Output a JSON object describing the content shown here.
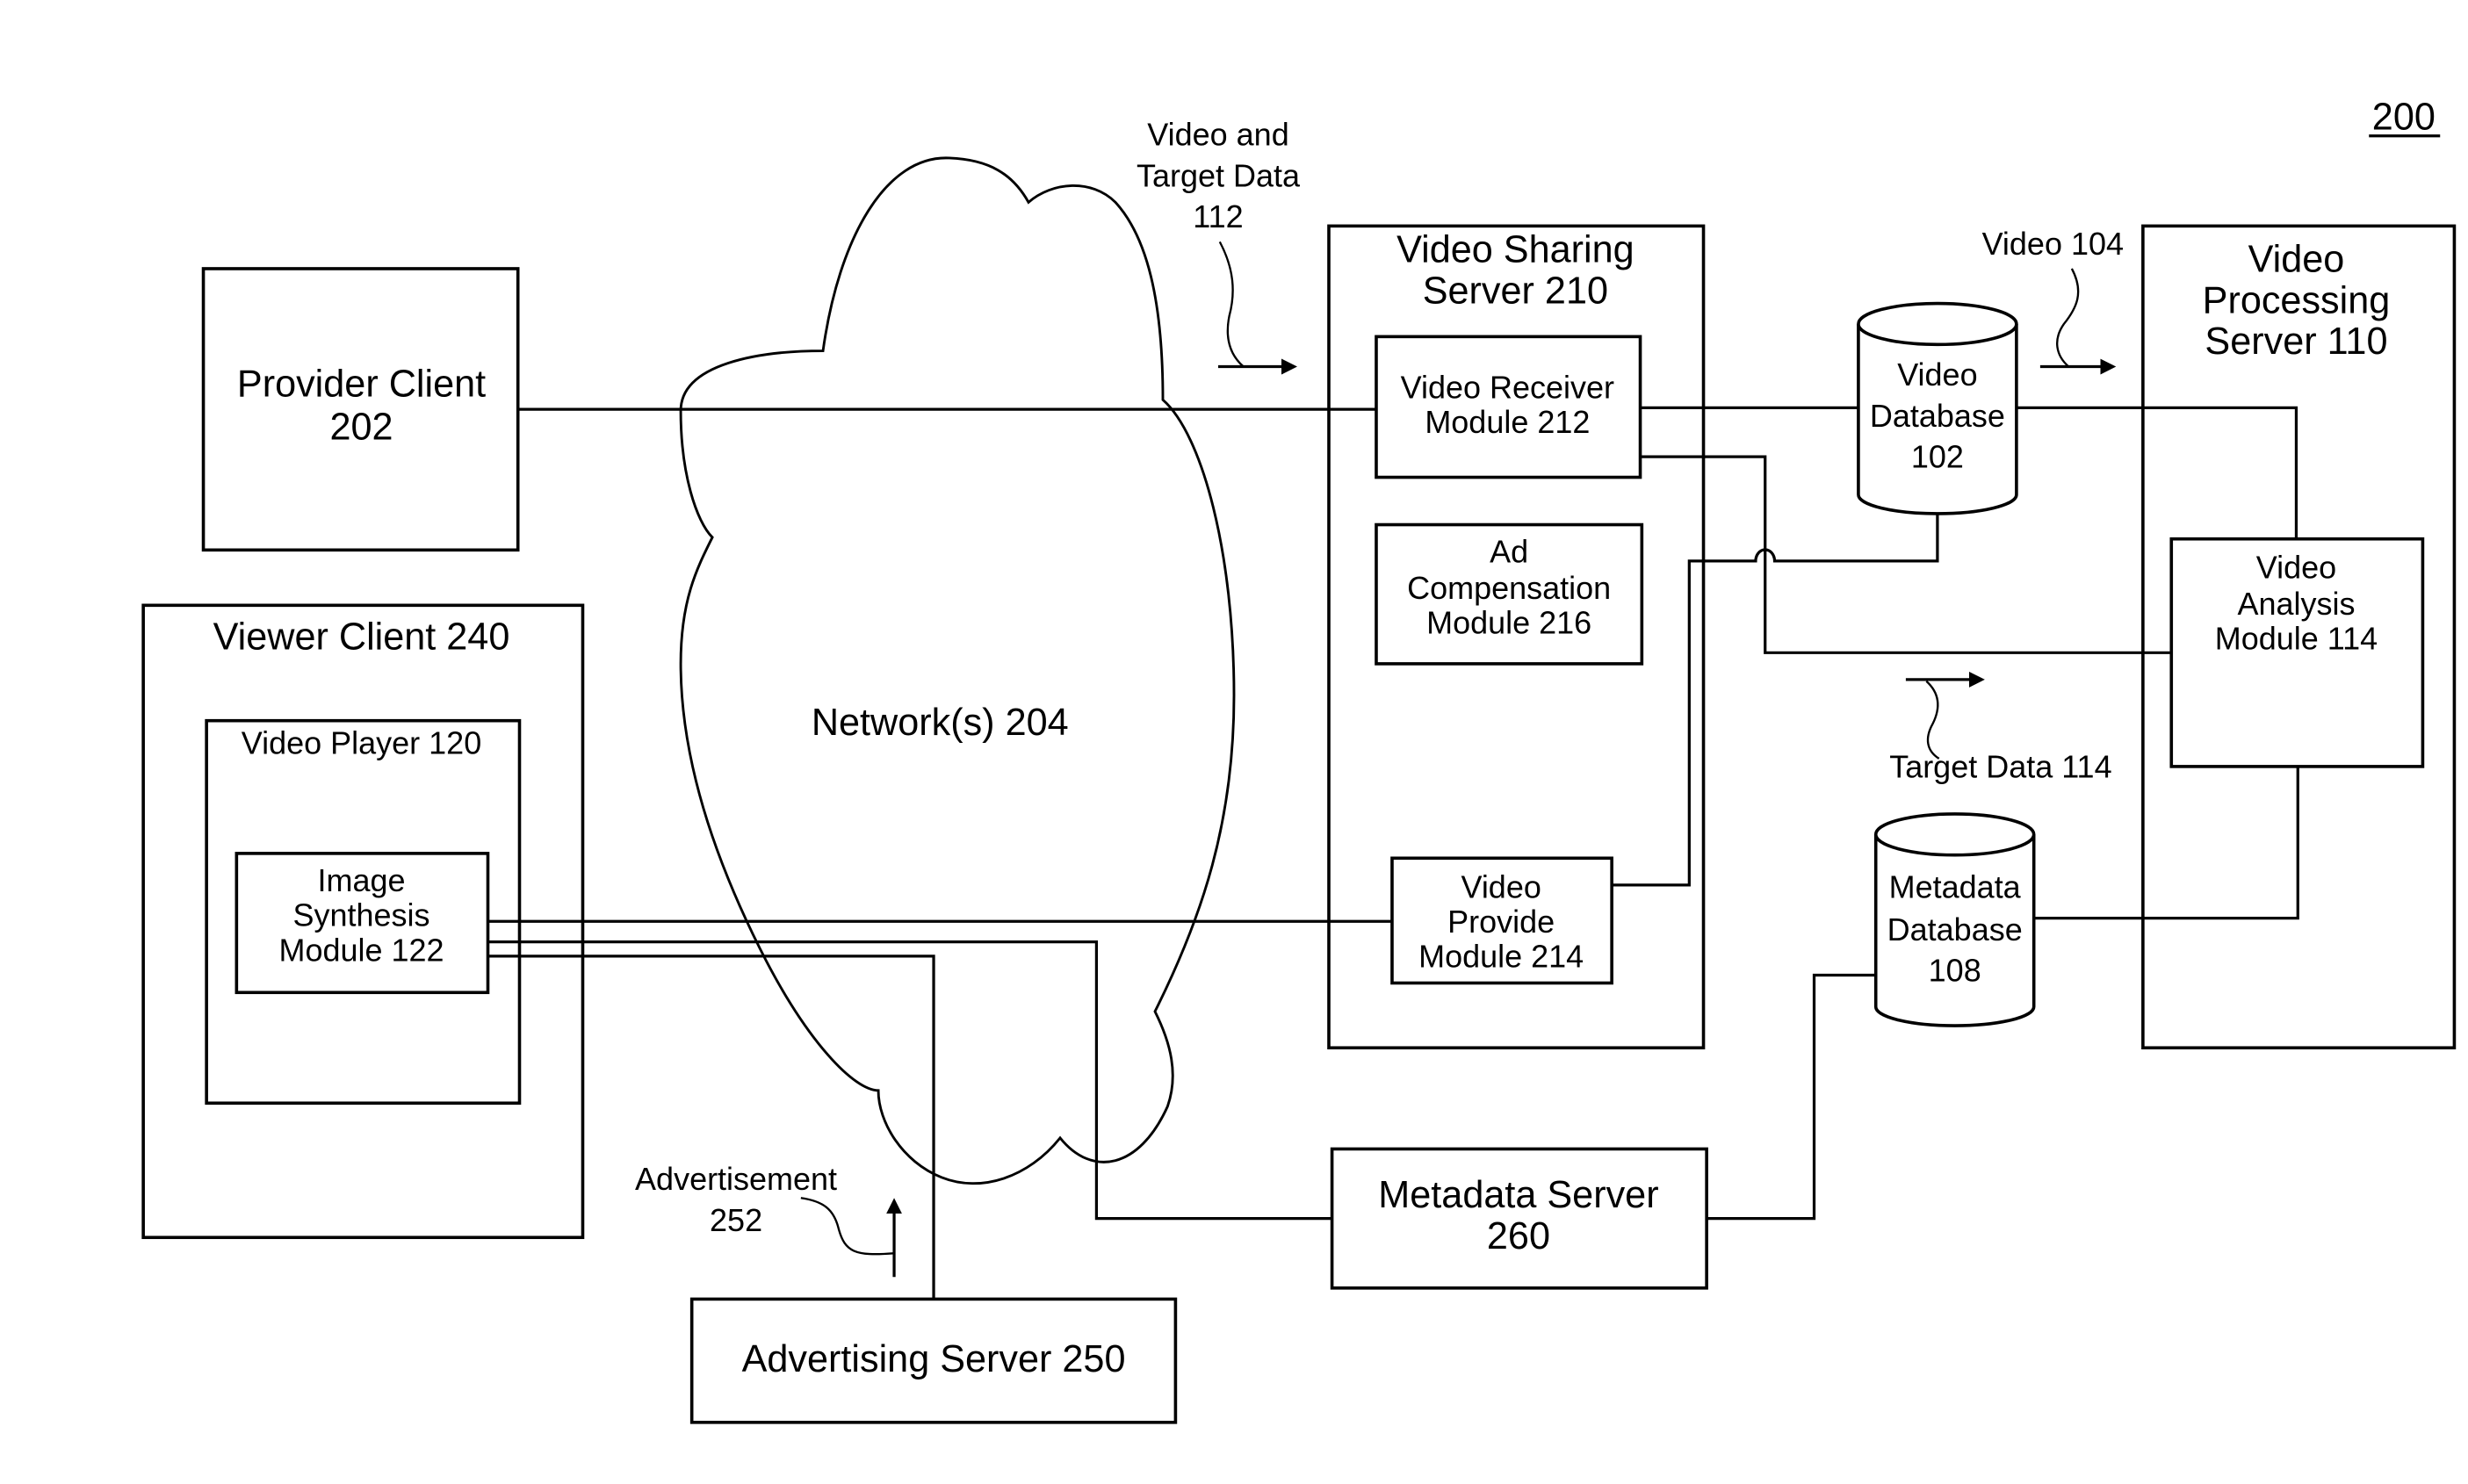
{
  "figure": {
    "number": "200",
    "network": {
      "label": "Network(s) 204"
    },
    "provider_client": {
      "lines": [
        "Provider Client",
        "202"
      ]
    },
    "viewer_client": {
      "title": "Viewer Client 240",
      "video_player": {
        "title": "Video Player 120",
        "image_synthesis": {
          "lines": [
            "Image",
            "Synthesis",
            "Module 122"
          ]
        }
      }
    },
    "video_sharing_server": {
      "lines": [
        "Video Sharing",
        "Server 210"
      ],
      "video_receiver": {
        "lines": [
          "Video Receiver",
          "Module 212"
        ]
      },
      "ad_compensation": {
        "lines": [
          "Ad",
          "Compensation",
          "Module 216"
        ]
      },
      "video_provide": {
        "lines": [
          "Video",
          "Provide",
          "Module 214"
        ]
      }
    },
    "video_database": {
      "lines": [
        "Video",
        "Database",
        "102"
      ]
    },
    "metadata_database": {
      "lines": [
        "Metadata",
        "Database",
        "108"
      ]
    },
    "video_processing_server": {
      "lines": [
        "Video",
        "Processing",
        "Server 110"
      ],
      "video_analysis": {
        "lines": [
          "Video",
          "Analysis",
          "Module 114"
        ]
      }
    },
    "metadata_server": {
      "lines": [
        "Metadata Server",
        "260"
      ]
    },
    "advertising_server": {
      "label": "Advertising Server 250"
    },
    "annotations": {
      "video_target_data": [
        "Video and",
        "Target Data",
        "112"
      ],
      "video_104": "Video 104",
      "target_data_114": "Target Data 114",
      "advertisement": [
        "Advertisement",
        "252"
      ]
    }
  }
}
